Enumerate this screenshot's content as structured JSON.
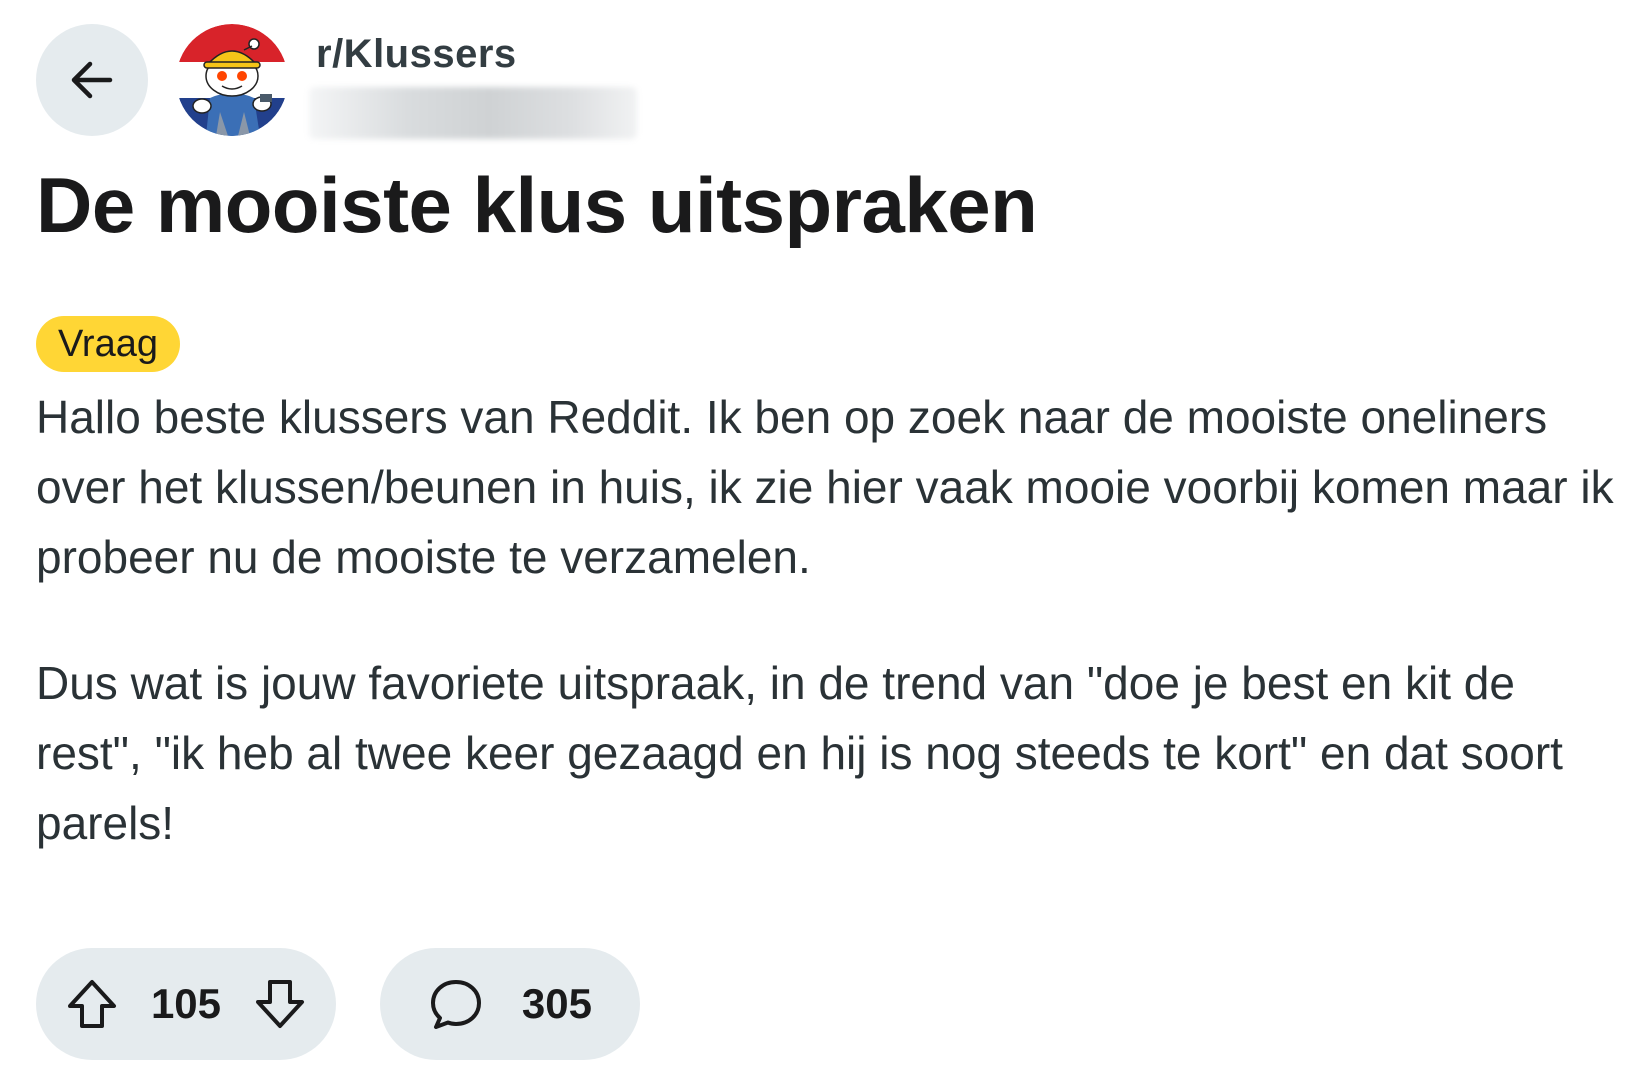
{
  "header": {
    "back_icon": "arrow-left-icon",
    "subreddit": "r/Klussers",
    "avatar_icon": "snoo-construction-worker-avatar",
    "meta_blurred": true
  },
  "post": {
    "title": "De mooiste klus uitspraken",
    "flair": "Vraag",
    "flair_color": "#ffd635",
    "paragraphs": [
      "Hallo beste klussers van Reddit. Ik ben op zoek naar de mooiste oneliners over het klussen/beunen in huis, ik zie hier vaak mooie voorbij komen maar ik probeer nu de mooiste te verzamelen.",
      "Dus wat is jouw favoriete uitspraak, in de trend van \"doe je best en kit de rest\", \"ik heb al twee keer gezaagd en hij is nog steeds te kort\" en dat soort parels!"
    ]
  },
  "actions": {
    "upvote_icon": "upvote-arrow-icon",
    "score": "105",
    "downvote_icon": "downvote-arrow-icon",
    "comment_icon": "comment-bubble-icon",
    "comments": "305"
  }
}
